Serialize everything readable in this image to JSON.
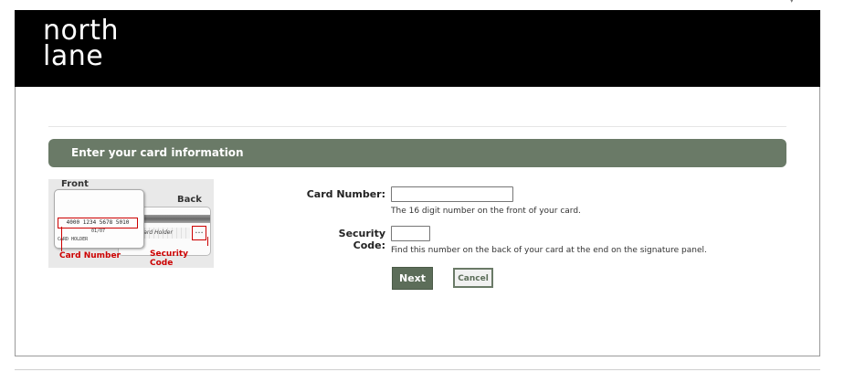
{
  "brand": {
    "line1": "north",
    "line2": "lane"
  },
  "section": {
    "title": "Enter your card information"
  },
  "illustration": {
    "front_label": "Front",
    "back_label": "Back",
    "card_number_sample": "4000 1234 5678 5010",
    "expiry_sample": "01/07",
    "holder_sample": "CARD HOLDER",
    "signature_sample": "Card Holder",
    "card_number_caption": "Card Number",
    "security_code_caption": "Security Code"
  },
  "form": {
    "card_number": {
      "label": "Card Number:",
      "value": "",
      "hint": "The 16 digit number on the front of your card."
    },
    "security_code": {
      "label": "Security Code:",
      "value": "",
      "hint": "Find this number on the back of your card at the end on the signature panel."
    },
    "next_label": "Next",
    "cancel_label": "Cancel"
  },
  "colors": {
    "header_bg": "#000000",
    "banner_bg": "#6a7a67",
    "next_bg": "#5c6d59",
    "caption_red": "#cc0000"
  }
}
